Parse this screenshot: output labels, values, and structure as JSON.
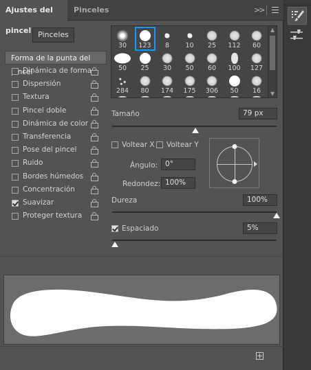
{
  "tabs": {
    "active": "Ajustes del pincel",
    "inactive": "Pinceles",
    "more_icon": "double-chevron-right-icon",
    "menu_icon": "hamburger-menu-icon"
  },
  "pinceles_button": "Pinceles",
  "sidebar": {
    "header": "Forma de la punta del pincel",
    "items": [
      {
        "label": "Dinámica de forma",
        "checked": false
      },
      {
        "label": "Dispersión",
        "checked": false
      },
      {
        "label": "Textura",
        "checked": false
      },
      {
        "label": "Pincel doble",
        "checked": false
      },
      {
        "label": "Dinámica de color",
        "checked": false
      },
      {
        "label": "Transferencia",
        "checked": false
      },
      {
        "label": "Pose del pincel",
        "checked": false
      },
      {
        "label": "Ruido",
        "checked": false
      },
      {
        "label": "Bordes húmedos",
        "checked": false
      },
      {
        "label": "Concentración",
        "checked": false
      },
      {
        "label": "Suavizar",
        "checked": true
      },
      {
        "label": "Proteger textura",
        "checked": false
      }
    ]
  },
  "brush_sizes": [
    [
      "30",
      "123",
      "8",
      "10",
      "25",
      "112",
      "60"
    ],
    [
      "50",
      "25",
      "30",
      "50",
      "60",
      "100",
      "127"
    ],
    [
      "284",
      "80",
      "174",
      "175",
      "306",
      "50",
      "16"
    ]
  ],
  "selected_brush": "123",
  "size": {
    "label": "Tamaño",
    "value": "79 px"
  },
  "flip_x": {
    "label": "Voltear X",
    "checked": false
  },
  "flip_y": {
    "label": "Voltear Y",
    "checked": false
  },
  "angle": {
    "label": "Ángulo:",
    "value": "0°"
  },
  "roundness": {
    "label": "Redondez:",
    "value": "100%"
  },
  "hardness": {
    "label": "Dureza",
    "value": "100%"
  },
  "spacing": {
    "label": "Espaciado",
    "value": "5%",
    "checked": true
  },
  "colors": {
    "panel": "#535353",
    "selection": "#1e90ff",
    "preview_bg": "#6c6c6c"
  },
  "dock_icons": [
    "brush-settings-icon",
    "brush-presets-icon"
  ],
  "new_brush_icon": "new-brush-plus-icon"
}
